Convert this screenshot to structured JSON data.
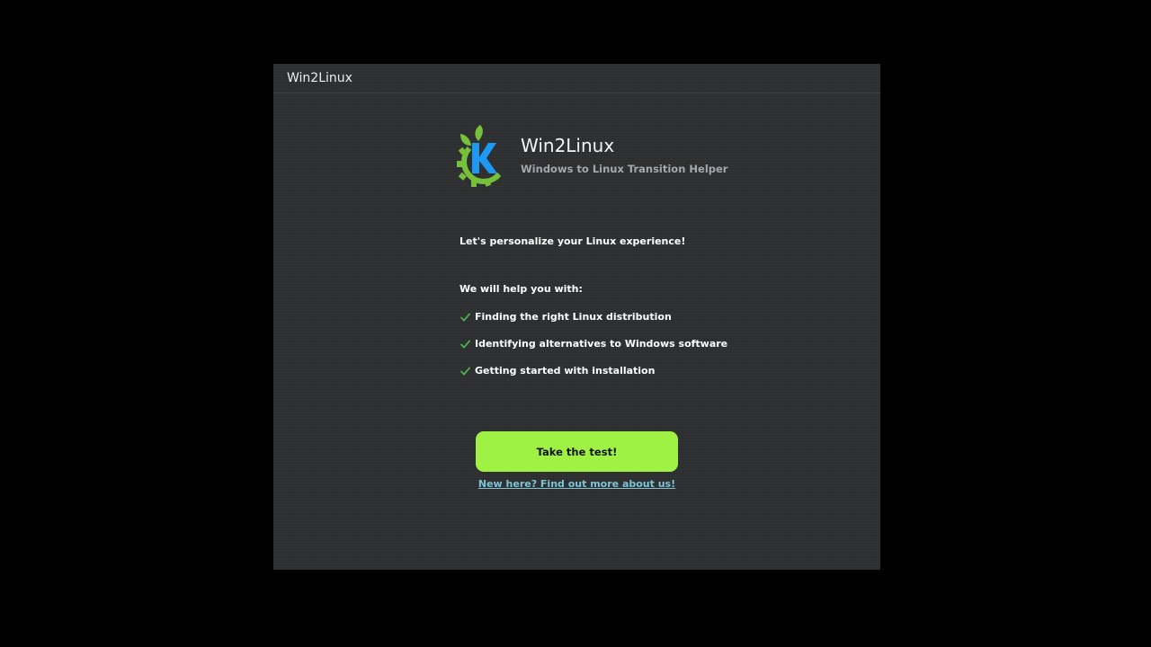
{
  "window": {
    "title": "Win2Linux"
  },
  "header": {
    "logo_icon": "kde-gear-leaf-logo-icon",
    "app_name": "Win2Linux",
    "tagline": "Windows to Linux Transition Helper"
  },
  "content": {
    "intro": "Let's personalize your Linux experience!",
    "help_heading": "We will help you with:",
    "features": [
      {
        "icon": "check-icon",
        "label": "Finding the right Linux distribution"
      },
      {
        "icon": "check-icon",
        "label": "Identifying alternatives to Windows software"
      },
      {
        "icon": "check-icon",
        "label": "Getting started with installation"
      }
    ]
  },
  "actions": {
    "primary_label": "Take the test!",
    "secondary_link": "New here? Find out more about us!"
  },
  "colors": {
    "accent_green": "#9ff244",
    "check_green": "#4caf50",
    "link_blue": "#7fc4d6",
    "logo_green": "#77c03a",
    "logo_blue": "#1d99f3"
  }
}
